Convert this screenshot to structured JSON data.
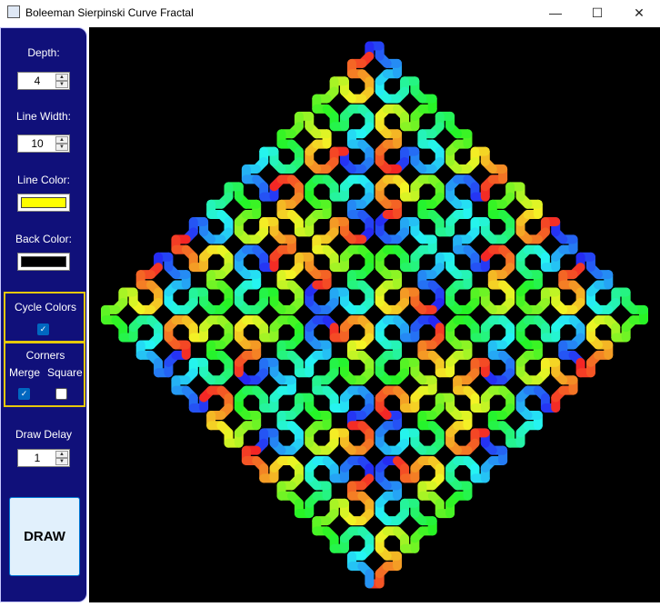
{
  "window": {
    "title": "Boleeman Sierpinski Curve Fractal"
  },
  "titlebar": {
    "minimize": "—",
    "maximize": "☐",
    "close": "✕"
  },
  "sidebar": {
    "depth_label": "Depth:",
    "depth_value": "4",
    "line_width_label": "Line Width:",
    "line_width_value": "10",
    "line_color_label": "Line Color:",
    "line_color": "#ffff00",
    "back_color_label": "Back Color:",
    "back_color": "#000000",
    "cycle_colors_label": "Cycle Colors",
    "cycle_colors_checked": true,
    "corners_label": "Corners",
    "merge_label": "Merge",
    "merge_checked": true,
    "square_label": "Square",
    "square_checked": false,
    "draw_delay_label": "Draw Delay",
    "draw_delay_value": "1",
    "draw_button": "DRAW"
  },
  "colors": {
    "sidebar_bg": "#10107a",
    "group_border": "#e6c80a",
    "canvas_bg": "#000000",
    "accent": "#0067c0"
  },
  "fractal": {
    "curve": "Sierpinski",
    "depth": 4
  }
}
